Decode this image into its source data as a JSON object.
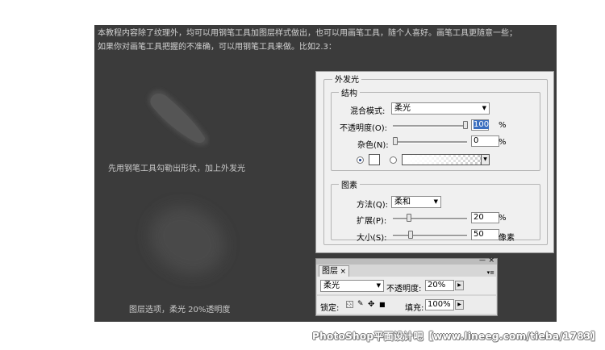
{
  "tutorial": {
    "line1": "本教程内容除了纹理外，均可以用钢笔工具加图层样式做出，也可以用画笔工具，随个人喜好。画笔工具更随意一些；",
    "line2": "如果你对画笔工具把握的不准确，可以用钢笔工具来做。比如2.3：",
    "caption1": "先用钢笔工具勾勒出形状，加上外发光",
    "caption2": "图层选项，柔光 20%透明度"
  },
  "outer_glow": {
    "title": "外发光",
    "structure": {
      "title": "结构",
      "blend_mode_label": "混合模式:",
      "blend_mode_value": "柔光",
      "opacity_label": "不透明度(O):",
      "opacity_value": "100",
      "opacity_unit": "%",
      "opacity_level": 1.0,
      "noise_label": "杂色(N):",
      "noise_value": "0",
      "noise_unit": "%",
      "noise_level": 0.0
    },
    "elements": {
      "title": "图素",
      "technique_label": "方法(Q):",
      "technique_value": "柔和",
      "spread_label": "扩展(P):",
      "spread_value": "20",
      "spread_unit": "%",
      "spread_level": 0.2,
      "size_label": "大小(S):",
      "size_value": "50",
      "size_unit": "像素"
    }
  },
  "layers_panel": {
    "tab_label": "图层",
    "tab_close": "×",
    "blend_value": "柔光",
    "opacity_label": "不透明度:",
    "opacity_value": "20%",
    "lock_label": "锁定:",
    "fill_label": "填充:",
    "fill_value": "100%",
    "minimize_glyph": "—",
    "close_glyph": "×",
    "menu_glyph": "▾≡"
  },
  "watermark": "PhotoShop平面设计吧【www.lineeg.com/tieba/1783】",
  "icons": {
    "dropdown": "chevron-down-icon",
    "stepper": "chevron-right-icon",
    "color_radio": "radio-icon",
    "lock_transparent": "checker-icon",
    "lock_brush": "brush-icon",
    "lock_move": "move-icon",
    "lock_all": "lock-icon"
  },
  "colors": {
    "canvas_bg": "#3b3b3b",
    "highlight": "#3a6ebf",
    "glow_color": "#ffffff"
  }
}
